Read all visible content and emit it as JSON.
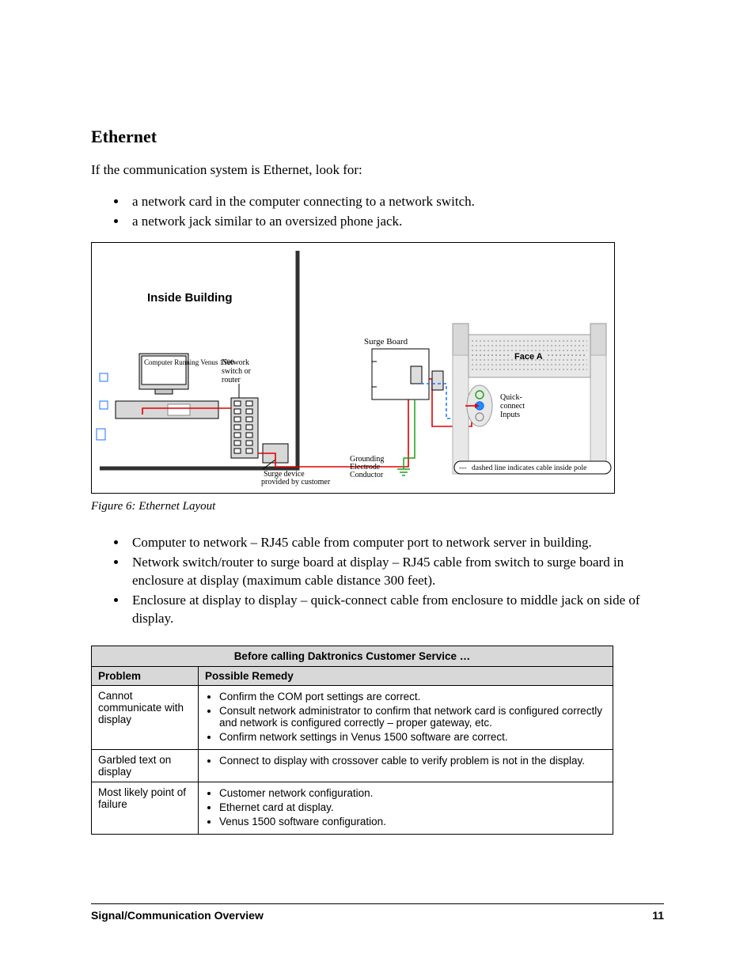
{
  "headings": {
    "ethernet": "Ethernet"
  },
  "intro": "If the communication system is Ethernet, look for:",
  "look_for": [
    "a network card in the computer connecting to a network switch.",
    "a network jack similar to an oversized phone jack."
  ],
  "figure": {
    "caption": "Figure 6: Ethernet Layout",
    "labels": {
      "inside_building": "Inside Building",
      "computer_running": "Computer Running Venus 1500",
      "network_switch": "Network switch or router",
      "surge_device": "Surge device provided by customer",
      "surge_board": "Surge Board",
      "grounding": "Grounding Electrode Conductor",
      "face_a": "Face A",
      "quick_connect": "Quick-connect Inputs",
      "dashed_note": "dashed line indicates cable inside pole"
    }
  },
  "connections": [
    "Computer to network – RJ45 cable from computer port to network server in building.",
    "Network switch/router to surge board at display – RJ45 cable from switch to surge board in enclosure at display (maximum cable distance 300 feet).",
    "Enclosure at display to display – quick-connect cable from enclosure to middle jack on side of display."
  ],
  "table": {
    "title": "Before calling Daktronics Customer Service …",
    "col1": "Problem",
    "col2": "Possible Remedy",
    "rows": [
      {
        "problem": "Cannot communicate with display",
        "remedies": [
          "Confirm the COM port settings are correct.",
          "Consult network administrator to confirm that network card is configured correctly and network is configured correctly – proper gateway, etc.",
          "Confirm network settings in Venus 1500 software are correct."
        ]
      },
      {
        "problem": "Garbled text on display",
        "remedies": [
          "Connect to display with crossover cable to verify problem is not in the display."
        ]
      },
      {
        "problem": "Most likely point of failure",
        "remedies": [
          "Customer network configuration.",
          "Ethernet card at display.",
          "Venus 1500 software configuration."
        ]
      }
    ]
  },
  "footer": {
    "left": "Signal/Communication Overview",
    "right": "11"
  }
}
